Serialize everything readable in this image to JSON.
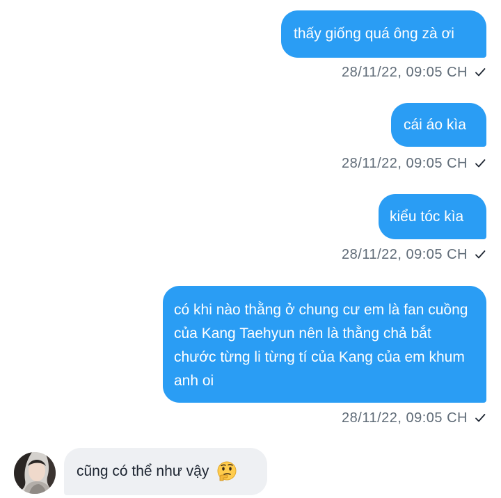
{
  "conversation": {
    "outgoing": [
      {
        "text": "thấy giống quá ông zà ơi",
        "timestamp": "28/11/22,  09:05 CH"
      },
      {
        "text": "cái áo kìa",
        "timestamp": "28/11/22,  09:05 CH"
      },
      {
        "text": "kiểu tóc kìa",
        "timestamp": "28/11/22,  09:05 CH"
      },
      {
        "text": "có khi nào thằng ở chung cư em là fan cuồng của Kang Taehyun nên là thằng chả bắt chước từng li từng tí của Kang của em khum anh oi",
        "timestamp": "28/11/22,  09:05 CH"
      }
    ],
    "incoming": [
      {
        "text": "cũng có thể như vậy",
        "emoji": "thinking-face-emoji"
      }
    ]
  },
  "colors": {
    "outgoing_bubble": "#2a9df4",
    "incoming_bubble": "#eef0f3",
    "timestamp_text": "#5f6b77"
  },
  "icons": {
    "sent_status": "check-icon",
    "avatar": "user-avatar"
  }
}
